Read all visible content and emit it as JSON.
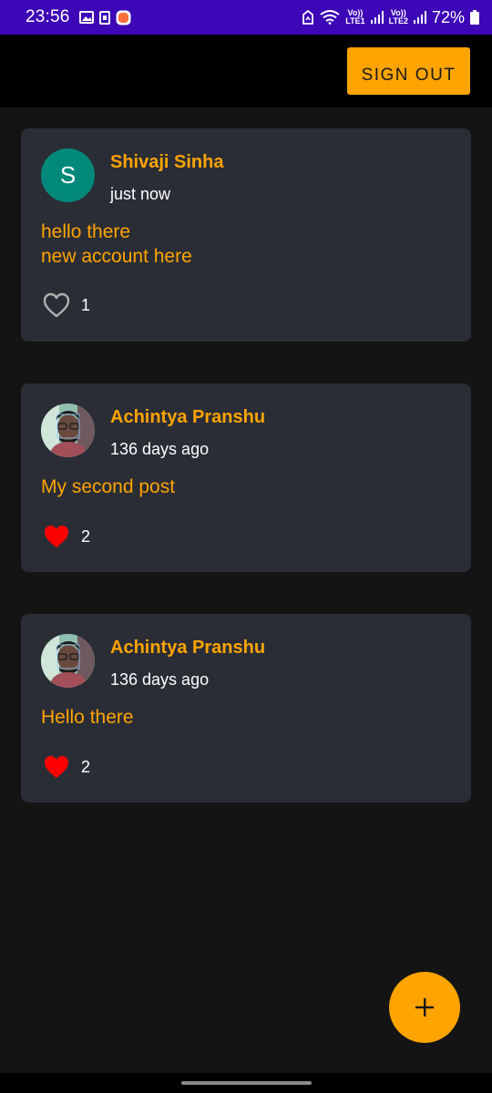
{
  "status_bar": {
    "time": "23:56",
    "left_icons": [
      "image-icon",
      "sim-icon",
      "app-notification-icon"
    ],
    "right_icons": [
      "cast-icon",
      "wifi-icon",
      "signal-icon",
      "signal-icon",
      "battery-icon"
    ],
    "net1_top": "Vo))",
    "net1_bottom": "LTE1",
    "net2_top": "Vo))",
    "net2_bottom": "LTE2",
    "battery": "72%"
  },
  "app_bar": {
    "sign_out_label": "SIGN OUT"
  },
  "posts": [
    {
      "avatar_letter": "S",
      "author": "Shivaji Sinha",
      "time": "just now",
      "content_lines": [
        "hello there",
        "new account here"
      ],
      "liked": false,
      "likes": "1"
    },
    {
      "avatar_letter": "",
      "author": "Achintya Pranshu",
      "time": "136 days ago",
      "content_lines": [
        "My second post"
      ],
      "liked": true,
      "likes": "2"
    },
    {
      "avatar_letter": "",
      "author": "Achintya Pranshu",
      "time": "136 days ago",
      "content_lines": [
        "Hello there"
      ],
      "liked": true,
      "likes": "2"
    }
  ],
  "fab": {
    "icon": "plus-icon"
  },
  "colors": {
    "accent": "#ffa400",
    "status_bar": "#3d06b6",
    "card": "#2a2d36",
    "background": "#141414",
    "like_active": "#ff0000",
    "avatar_bg": "#00897b"
  }
}
